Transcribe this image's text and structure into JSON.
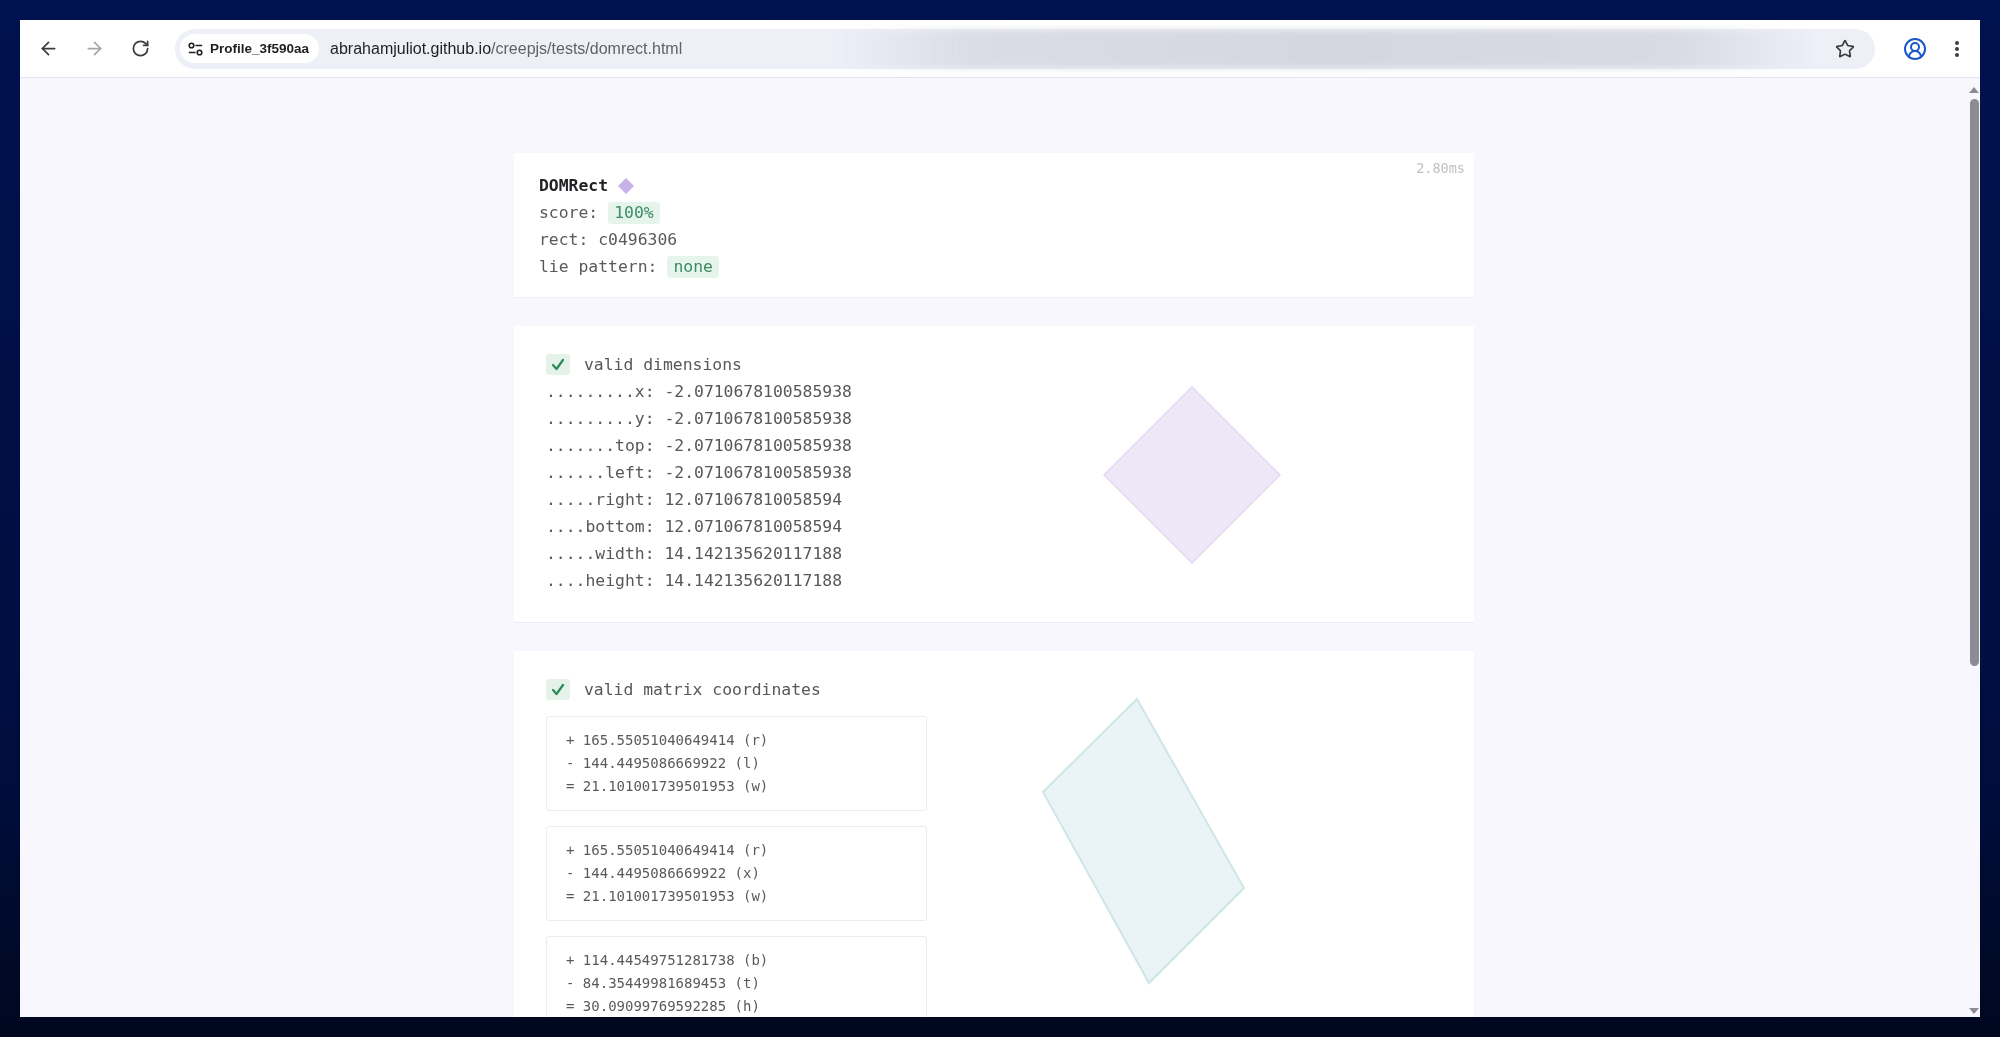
{
  "toolbar": {
    "forward_disabled": true,
    "profile_chip": "Profile_3f590aa",
    "url": {
      "host": "abrahamjuliot.github.io",
      "path": "/creepjs/tests/domrect.html"
    }
  },
  "summary": {
    "title": "DOMRect",
    "time": "2.80ms",
    "fields": [
      {
        "kind": "badge",
        "label": "score:",
        "value": "100%"
      },
      {
        "kind": "text",
        "text": "rect: c0496306"
      },
      {
        "kind": "badge",
        "label": "lie pattern:",
        "value": "none"
      }
    ]
  },
  "dimensions": {
    "passed": true,
    "title": "valid dimensions",
    "rows": [
      ".........x: -2.0710678100585938",
      ".........y: -2.0710678100585938",
      ".......top: -2.0710678100585938",
      "......left: -2.0710678100585938",
      ".....right: 12.071067810058594",
      "....bottom: 12.071067810058594",
      ".....width: 14.142135620117188",
      "....height: 14.142135620117188"
    ]
  },
  "matrix": {
    "passed": true,
    "title": "valid matrix coordinates",
    "boxes": [
      [
        "+ 165.55051040649414 (r)",
        "- 144.4495086669922 (l)",
        "= 21.101001739501953 (w)"
      ],
      [
        "+ 165.55051040649414 (r)",
        "- 144.4495086669922 (x)",
        "= 21.101001739501953 (w)"
      ],
      [
        "+ 114.44549751281738 (b)",
        "- 84.35449981689453 (t)",
        "= 30.09099769592285 (h)"
      ]
    ]
  }
}
